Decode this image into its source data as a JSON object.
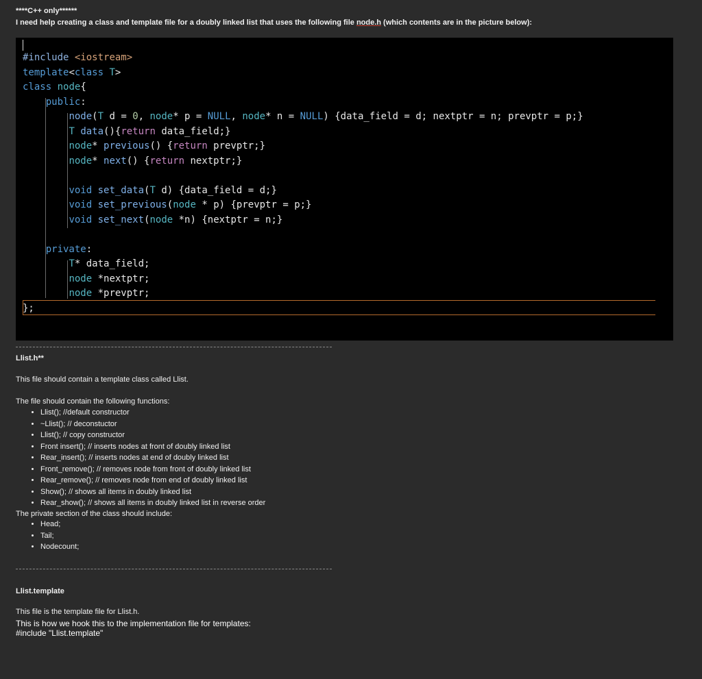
{
  "header": {
    "tag": "****C++ only******",
    "request_prefix": "I need help creating a class and template file for a doubly linked list that uses the following file ",
    "request_link": "node.h",
    "request_suffix": " (which contents are in the picture below):"
  },
  "code": {
    "language": "cpp",
    "lines": [
      "#include <iostream>",
      "template<class T>",
      "class node{",
      "    public:",
      "        node(T d = 0, node* p = NULL, node* n = NULL) {data_field = d; nextptr = n; prevptr = p;}",
      "        T data(){return data_field;}",
      "        node* previous() {return prevptr;}",
      "        node* next() {return nextptr;}",
      "",
      "        void set_data(T d) {data_field = d;}",
      "        void set_previous(node * p) {prevptr = p;}",
      "        void set_next(node *n) {nextptr = n;}",
      "",
      "    private:",
      "        T* data_field;",
      "        node *nextptr;",
      "        node *prevptr;",
      "};"
    ]
  },
  "section1": {
    "filename": "Llist.h**",
    "description": "This file should contain a template class called Llist.",
    "functions_intro": "The file should contain the following functions:",
    "functions": [
      "Llist(); //default constructor",
      "~Llist(); // deconstuctor",
      "Llist(); // copy constructor",
      "Front insert(); // inserts nodes at front of doubly linked list",
      "Rear_insert(); // inserts nodes at end of doubly linked list",
      "Front_remove(); // removes node from front of doubly linked list",
      "Rear_remove(); // removes node from end of doubly linked list",
      "Show(); // shows all items in doubly linked list",
      "Rear_show(); // shows all items in doubly linked list in reverse order"
    ],
    "private_intro": "The private section of the class should include:",
    "private_members": [
      "Head;",
      "Tail;",
      "Nodecount;"
    ]
  },
  "section2": {
    "filename": "Llist.template",
    "description": "This file is the template file for Llist.h.",
    "hook_text": "This is how we hook this to the implementation file for templates:",
    "include_line": "#include \"Llist.template\""
  }
}
